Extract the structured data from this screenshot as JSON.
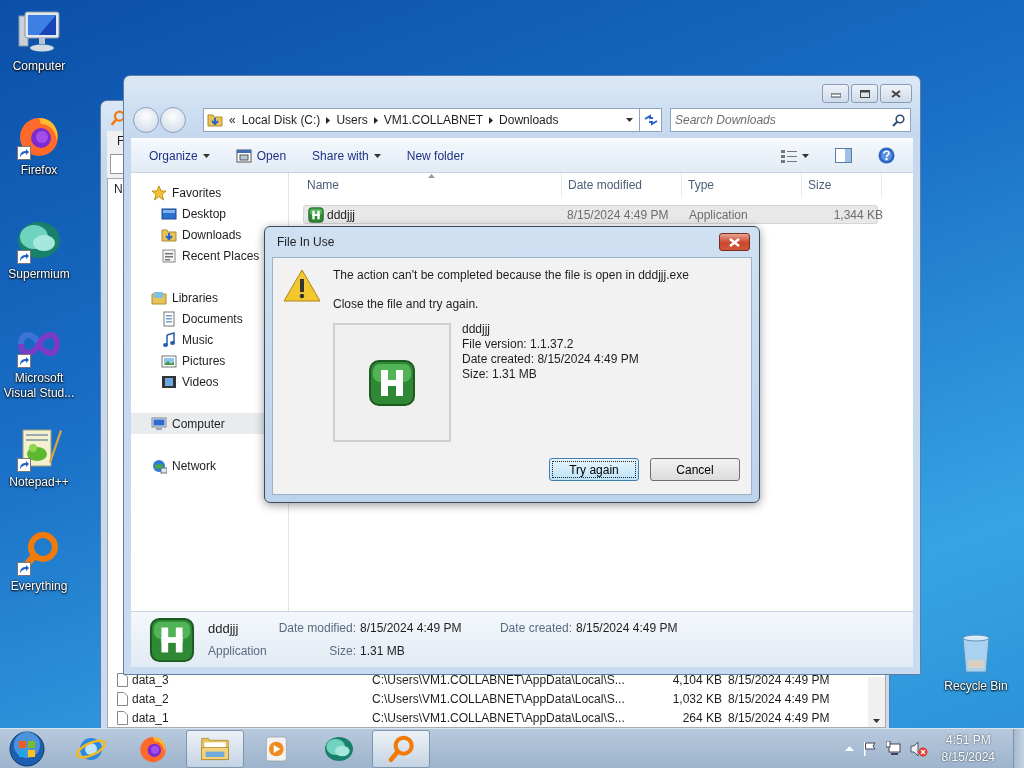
{
  "desktop_icons": [
    {
      "label": "Computer",
      "shortcut": false
    },
    {
      "label": "Firefox",
      "shortcut": true
    },
    {
      "label": "Supermium",
      "shortcut": true
    },
    {
      "label": "Microsoft Visual Stud...",
      "shortcut": true
    },
    {
      "label": "Notepad++",
      "shortcut": true
    },
    {
      "label": "Everything",
      "shortcut": true
    }
  ],
  "recycle_bin": {
    "label": "Recycle Bin"
  },
  "background_window": {
    "menu_item": "F",
    "column_header": "N",
    "rows": [
      {
        "name": "data_3",
        "path": "C:\\Users\\VM1.COLLABNET\\AppData\\Local\\S...",
        "size": "4,104 KB",
        "date": "8/15/2024 4:49 PM"
      },
      {
        "name": "data_2",
        "path": "C:\\Users\\VM1.COLLABNET\\AppData\\Local\\S...",
        "size": "1,032 KB",
        "date": "8/15/2024 4:49 PM"
      },
      {
        "name": "data_1",
        "path": "C:\\Users\\VM1.COLLABNET\\AppData\\Local\\S...",
        "size": "264 KB",
        "date": "8/15/2024 4:49 PM"
      }
    ]
  },
  "explorer": {
    "breadcrumb_overflow": "«",
    "breadcrumb": [
      "Local Disk (C:)",
      "Users",
      "VM1.COLLABNET",
      "Downloads"
    ],
    "search": {
      "placeholder": "Search Downloads"
    },
    "toolbar": [
      {
        "label": "Organize",
        "dropdown": true
      },
      {
        "label": "Open",
        "dropdown": false
      },
      {
        "label": "Share with",
        "dropdown": true
      },
      {
        "label": "New folder",
        "dropdown": false
      }
    ],
    "nav": [
      {
        "label": "Favorites",
        "selected": false,
        "children": [
          {
            "label": "Desktop",
            "selected": false
          },
          {
            "label": "Downloads",
            "selected": false
          },
          {
            "label": "Recent Places",
            "selected": false
          }
        ]
      },
      {
        "label": "Libraries",
        "selected": false,
        "children": [
          {
            "label": "Documents",
            "selected": false
          },
          {
            "label": "Music",
            "selected": false
          },
          {
            "label": "Pictures",
            "selected": false
          },
          {
            "label": "Videos",
            "selected": false
          }
        ]
      },
      {
        "label": "Computer",
        "selected": true
      },
      {
        "label": "Network",
        "selected": false
      }
    ],
    "columns": [
      "Name",
      "Date modified",
      "Type",
      "Size"
    ],
    "files": [
      {
        "name": "dddjjj",
        "date_modified": "8/15/2024 4:49 PM",
        "type": "Application",
        "size": "1,344 KB",
        "selected": true
      }
    ],
    "details": {
      "name": "dddjjj",
      "type": "Application",
      "fields": [
        {
          "label": "Date modified:",
          "value": "8/15/2024 4:49 PM"
        },
        {
          "label": "Date created:",
          "value": "8/15/2024 4:49 PM"
        },
        {
          "label": "Size:",
          "value": "1.31 MB"
        }
      ]
    }
  },
  "dialog": {
    "title": "File In Use",
    "message": "The action can't be completed because the file is open in dddjjj.exe",
    "hint": "Close the file and try again.",
    "file_info": [
      "dddjjj",
      "File version: 1.1.37.2",
      "Date created: 8/15/2024 4:49 PM",
      "Size: 1.31 MB"
    ],
    "buttons": [
      {
        "label": "Try again",
        "focused": true
      },
      {
        "label": "Cancel",
        "focused": false
      }
    ]
  },
  "taskbar": {
    "apps": [
      {
        "active": false
      },
      {
        "active": false
      },
      {
        "active": true
      },
      {
        "active": false
      },
      {
        "active": false
      },
      {
        "active": true
      }
    ],
    "clock": {
      "time": "4:51 PM",
      "date": "8/15/2024"
    }
  }
}
